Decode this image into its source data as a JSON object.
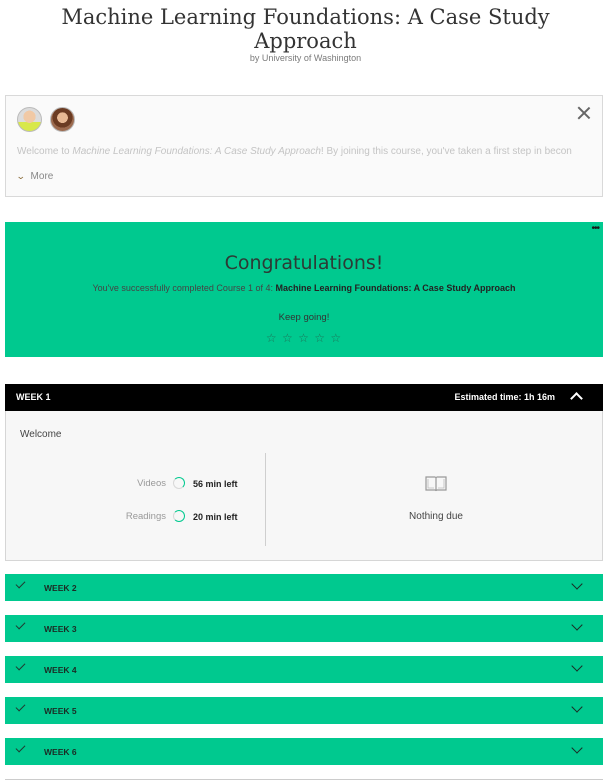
{
  "course": {
    "title_line1": "Machine Learning Foundations: A Case Study",
    "title_line2": "Approach",
    "byline": "by University of Washington"
  },
  "welcome": {
    "text_prefix": "Welcome to ",
    "text_course": "Machine Learning Foundations: A Case Study Approach",
    "text_suffix": "! By joining this course, you've taken a first step in becon",
    "more_label": "More"
  },
  "congrats": {
    "heading": "Congratulations!",
    "line_prefix": "You've successfully completed Course 1 of 4: ",
    "line_course": "Machine Learning Foundations: A Case Study Approach",
    "keep_going": "Keep going!",
    "rating": {
      "max": 5,
      "value": 0,
      "star": "☆"
    }
  },
  "week1": {
    "label": "WEEK 1",
    "estimated_time": "Estimated time: 1h 16m",
    "module": "Welcome",
    "videos_label": "Videos",
    "videos_left": "56 min left",
    "readings_label": "Readings",
    "readings_left": "20 min left",
    "nothing_due": "Nothing due"
  },
  "weeks": [
    {
      "label": "WEEK 2"
    },
    {
      "label": "WEEK 3"
    },
    {
      "label": "WEEK 4"
    },
    {
      "label": "WEEK 5"
    },
    {
      "label": "WEEK 6"
    }
  ],
  "colors": {
    "accent_green": "#00c98f",
    "header_black": "#000000",
    "more_chevron": "#8a6c3a"
  },
  "icons": [
    "close-icon",
    "chevron-down-icon",
    "more-options-icon",
    "star-icon",
    "chevron-up-icon",
    "progress-ring-icon",
    "book-icon",
    "check-icon"
  ]
}
